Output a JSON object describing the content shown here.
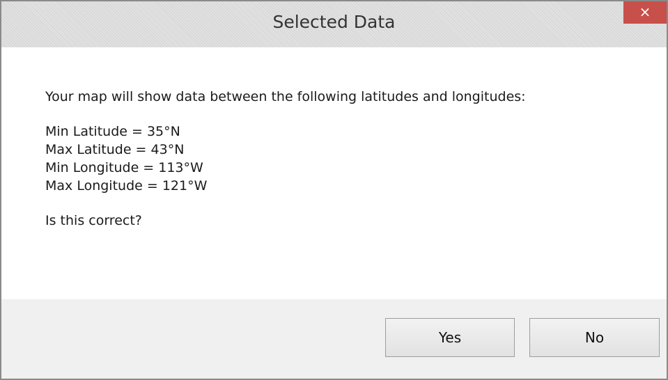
{
  "window": {
    "title": "Selected Data",
    "close_glyph": "×"
  },
  "message": {
    "intro": "Your map will show data between the following latitudes and longitudes:",
    "lines": [
      "Min Latitude = 35°N",
      "Max Latitude = 43°N",
      "Min Longitude = 113°W",
      "Max Longitude = 121°W"
    ],
    "question": "Is this correct?"
  },
  "buttons": {
    "yes_label": "Yes",
    "no_label": "No"
  },
  "colors": {
    "close_button": "#c7504b",
    "footer_background": "#f0f0f0"
  }
}
